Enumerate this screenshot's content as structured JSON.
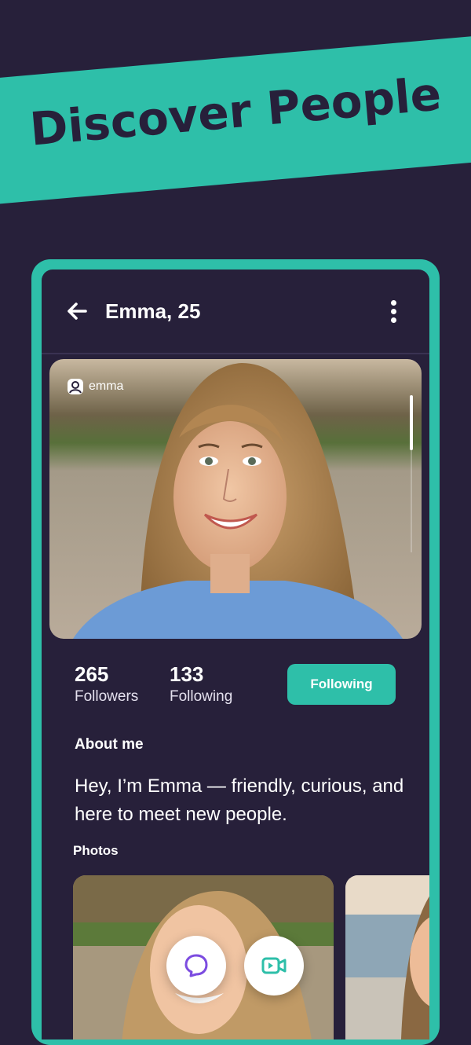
{
  "banner": {
    "title": "Discover People"
  },
  "appbar": {
    "title": "Emma, 25"
  },
  "profile": {
    "handle": "emma",
    "followers_count": "265",
    "followers_label": "Followers",
    "following_count": "133",
    "following_label": "Following",
    "follow_button_label": "Following"
  },
  "about": {
    "title": "About me",
    "text": "Hey, I’m Emma — friendly, curious, and here to meet new people."
  },
  "photos": {
    "title": "Photos"
  },
  "actions": {
    "chat_icon": "chat-bubble-icon",
    "video_icon": "video-camera-icon"
  },
  "colors": {
    "accent": "#2ebfa9",
    "background": "#27203a",
    "chat_icon": "#7c4ce0"
  }
}
